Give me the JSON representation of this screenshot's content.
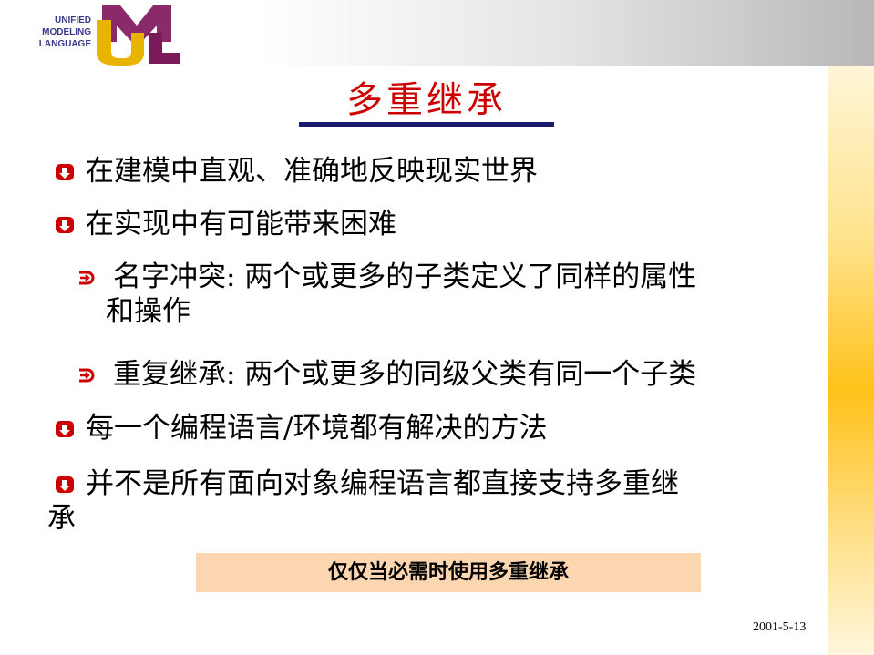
{
  "logo": {
    "lines": [
      "UNIFIED",
      "MODELING",
      "LANGUAGE"
    ],
    "colors": {
      "u": "#e8b400",
      "m": "#8a2a6a",
      "l": "#7a1a5a",
      "text": "#3a3a8a"
    }
  },
  "title": "多重继承",
  "bullets": [
    {
      "text": "在建模中直观、准确地反映现实世界"
    },
    {
      "text": "在实现中有可能带来困难"
    }
  ],
  "sub_bullets": [
    {
      "line1": "名字冲突: 两个或更多的子类定义了同样的属性",
      "line2": "和操作"
    },
    {
      "text": "重复继承: 两个或更多的同级父类有同一个子类"
    }
  ],
  "bullets_more": [
    {
      "text": "每一个编程语言/环境都有解决的方法"
    },
    {
      "line1": "并不是所有面向对象编程语言都直接支持多重继",
      "line2": "承"
    }
  ],
  "note": "仅仅当必需时使用多重继承",
  "date": "2001-5-13",
  "colors": {
    "title": "#cc0000",
    "title_rule": "#1a1a6e",
    "bullet_mark": "#cc0000",
    "note_bg": "#fbd6b0",
    "side_band": "#ffc21a"
  }
}
